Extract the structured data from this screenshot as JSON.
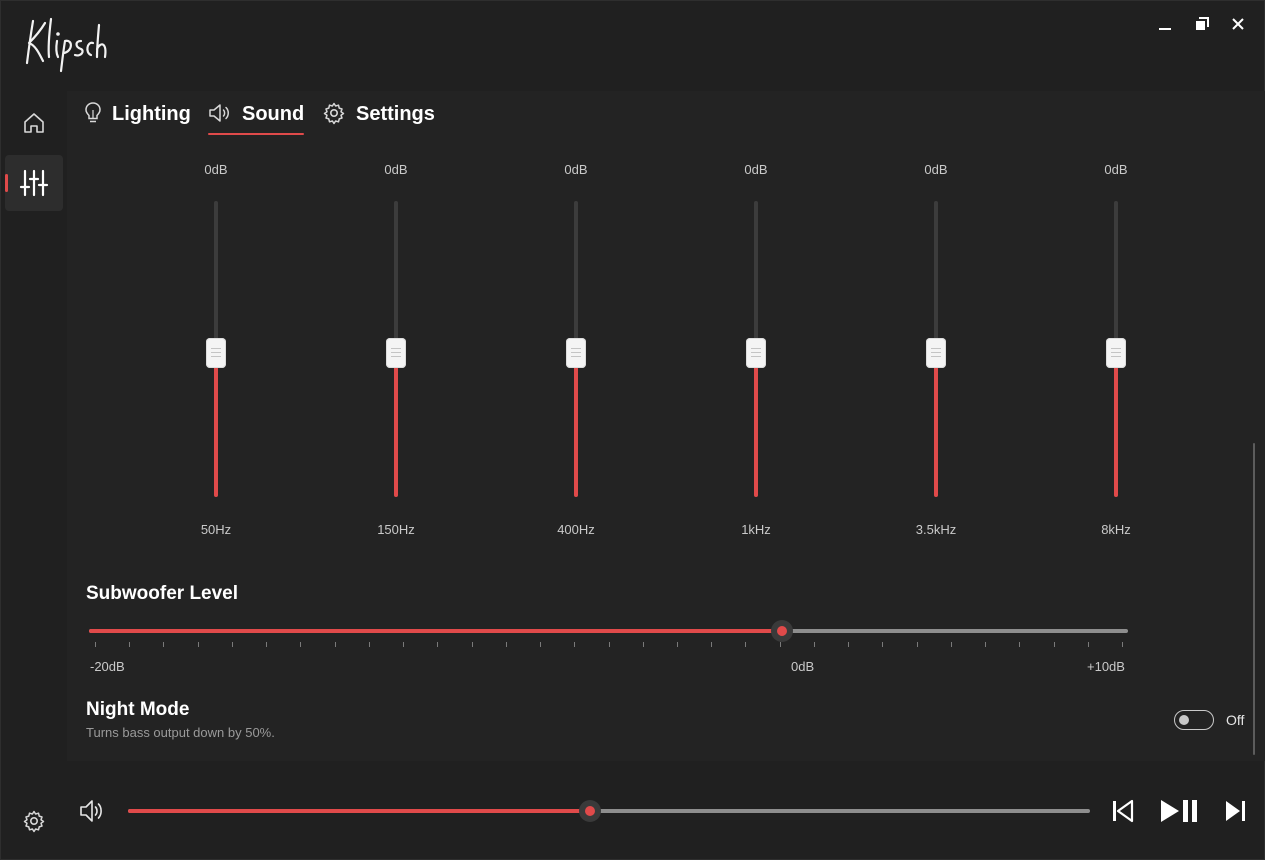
{
  "app": {
    "logo_text": "Klipsch",
    "window_controls": {
      "minimize": "minimize-icon",
      "restore": "restore-icon",
      "close": "close-icon"
    }
  },
  "colors": {
    "accent": "#e04a4a",
    "background": "#202020",
    "panel": "#232323",
    "text": "#ffffff",
    "muted": "#c9c9c9"
  },
  "sidebar": {
    "items": [
      {
        "name": "home",
        "icon": "home-icon",
        "active": false
      },
      {
        "name": "equalizer",
        "icon": "sliders-icon",
        "active": true
      }
    ],
    "bottom_icon": "gear-icon"
  },
  "tabs": [
    {
      "label": "Lighting",
      "icon": "lightbulb-icon",
      "active": false
    },
    {
      "label": "Sound",
      "icon": "speaker-icon",
      "active": true
    },
    {
      "label": "Settings",
      "icon": "gear-icon",
      "active": false
    }
  ],
  "equalizer": {
    "range_db": [
      -10,
      10
    ],
    "bands": [
      {
        "freq": "50Hz",
        "value_label": "0dB",
        "value": 0
      },
      {
        "freq": "150Hz",
        "value_label": "0dB",
        "value": 0
      },
      {
        "freq": "400Hz",
        "value_label": "0dB",
        "value": 0
      },
      {
        "freq": "1kHz",
        "value_label": "0dB",
        "value": 0
      },
      {
        "freq": "3.5kHz",
        "value_label": "0dB",
        "value": 0
      },
      {
        "freq": "8kHz",
        "value_label": "0dB",
        "value": 0
      }
    ]
  },
  "subwoofer": {
    "title": "Subwoofer Level",
    "min_label": "-20dB",
    "mid_label": "0dB",
    "max_label": "+10dB",
    "min": -20,
    "max": 10,
    "value": 0,
    "tick_count": 31
  },
  "night_mode": {
    "title": "Night Mode",
    "description": "Turns bass output down by 50%.",
    "state_label": "Off",
    "enabled": false
  },
  "player": {
    "volume_icon": "speaker-icon",
    "volume_fraction": 0.48,
    "prev_icon": "skip-previous-icon",
    "play_pause_icon": "play-pause-icon",
    "next_icon": "skip-next-icon"
  }
}
